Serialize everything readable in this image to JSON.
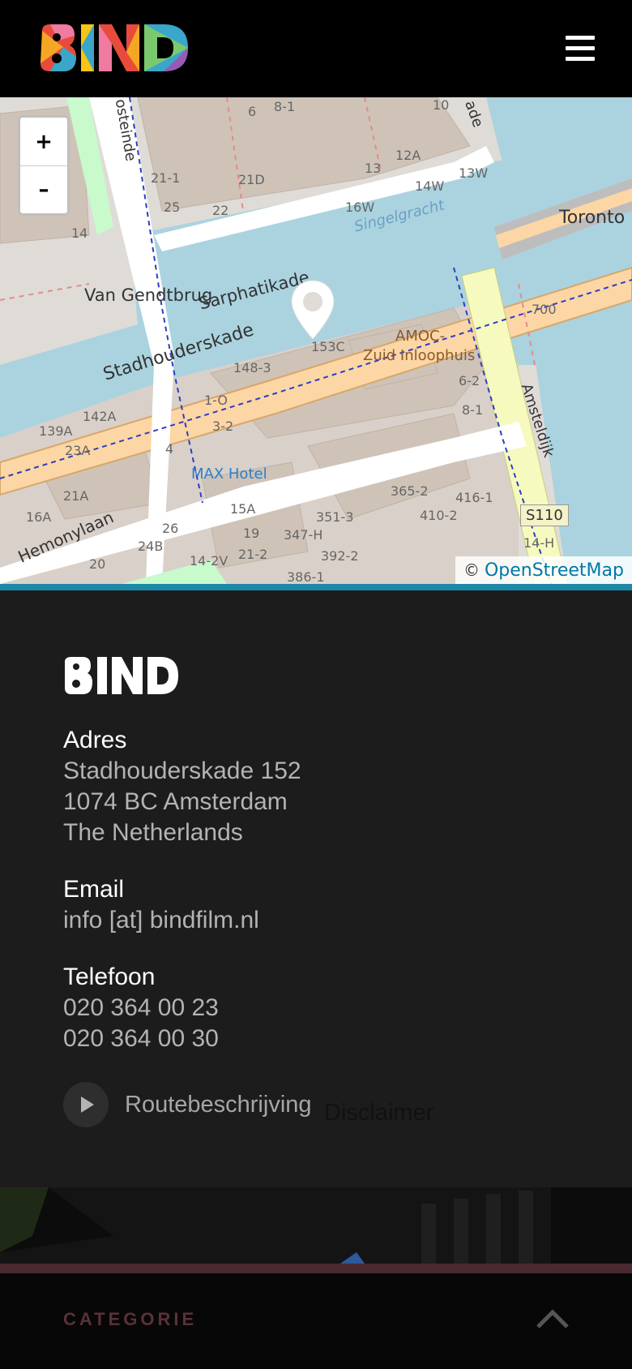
{
  "header": {
    "logo_text": "BIND",
    "menu_icon": "hamburger-icon"
  },
  "map": {
    "zoom_in_label": "+",
    "zoom_out_label": "–",
    "attribution_prefix": "©",
    "attribution_link": "OpenStreetMap",
    "labels": {
      "sarphatikade": "Sarphatikade",
      "van_gendtbrug": "Van Gendtbrug",
      "stadhouderskade": "Stadhouderskade",
      "singelgracht": "Singelgracht",
      "toronto": "Toronto",
      "amoc": "AMOC-",
      "zuid_inloophuis": "Zuid Inloophuis",
      "max_hotel": "MAX Hotel",
      "hemonylaan": "Hemonylaan",
      "amsteldijk": "Amsteldijk",
      "s110": "S110",
      "osteinde": "osteinde",
      "ade": "ade",
      "n153c": "153C",
      "n148_3": "148-3",
      "n142a": "142A",
      "n139a": "139A",
      "n23a": "23A",
      "n21a": "21A",
      "n16a": "16A",
      "n20": "20",
      "n24b": "24B",
      "n26": "26",
      "n15a": "15A",
      "n19": "19",
      "n21_2": "21-2",
      "n14_2v": "14-2V",
      "n347h": "347-H",
      "n351_3": "351-3",
      "n392_2": "392-2",
      "n386_1": "386-1",
      "n365_2": "365-2",
      "n410_2": "410-2",
      "n416_1": "416-1",
      "n14h": "14-H",
      "n6_2": "6-2",
      "n8_1": "8-1",
      "n700": "700",
      "n1_o": "1-O",
      "n3_2": "3-2",
      "n4": "4",
      "n21_1": "21-1",
      "n21d": "21D",
      "n25": "25",
      "n22": "22",
      "n16w": "16W",
      "n14w": "14W",
      "n13w": "13W",
      "n12a": "12A",
      "n13": "13",
      "n6": "6",
      "n8_1b": "8-1",
      "n10": "10",
      "n14": "14"
    }
  },
  "footer": {
    "logo_text": "BIND",
    "address_label": "Adres",
    "address_lines": [
      "Stadhouderskade 152",
      "1074 BC Amsterdam",
      "The Netherlands"
    ],
    "email_label": "Email",
    "email_value": "info [at] bindfilm.nl",
    "phone_label": "Telefoon",
    "phones": [
      "020 364 00 23",
      "020 364 00 30"
    ],
    "route_label": "Routebeschrijving",
    "disclaimer_label": "Disclaimer"
  },
  "bottom": {
    "categorie_label": "CATEGORIE"
  },
  "colors": {
    "accent_blue": "#1e88a8",
    "footer_bg": "#1c1c1d",
    "categorie": "#5a3138"
  }
}
